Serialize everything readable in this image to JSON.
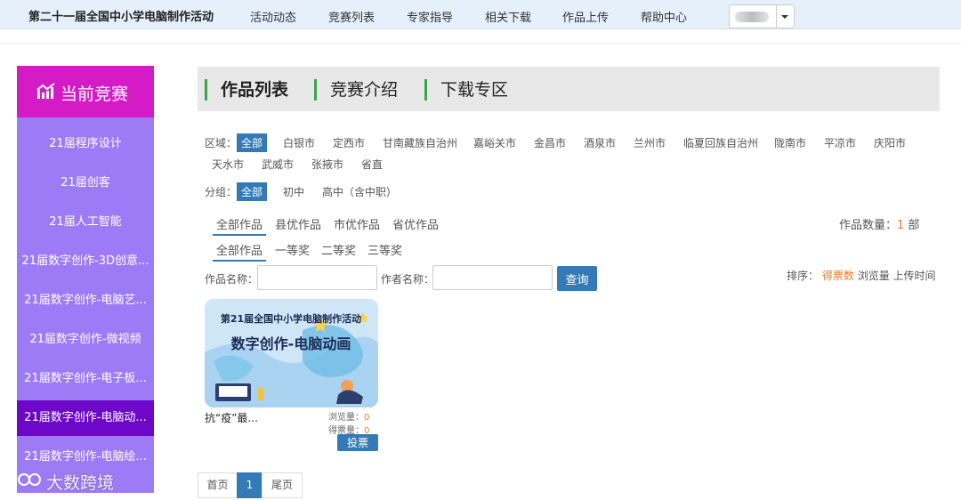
{
  "header": {
    "site_title": "第二十一届全国中小学电脑制作活动",
    "nav": [
      "活动动态",
      "竞赛列表",
      "专家指导",
      "相关下载",
      "作品上传",
      "帮助中心"
    ]
  },
  "sidebar": {
    "header_label": "当前竞赛",
    "items": [
      {
        "label": "21届程序设计"
      },
      {
        "label": "21届创客"
      },
      {
        "label": "21届人工智能"
      },
      {
        "label": "21届数字创作-3D创意..."
      },
      {
        "label": "21届数字创作-电脑艺..."
      },
      {
        "label": "21届数字创作-微视频"
      },
      {
        "label": "21届数字创作-电子板..."
      },
      {
        "label": "21届数字创作-电脑动..."
      },
      {
        "label": "21届数字创作-电脑绘..."
      }
    ]
  },
  "tabs": [
    "作品列表",
    "竞赛介绍",
    "下载专区"
  ],
  "filters": {
    "region_label": "区域：",
    "regions": [
      "全部",
      "白银市",
      "定西市",
      "甘南藏族自治州",
      "嘉峪关市",
      "金昌市",
      "酒泉市",
      "兰州市",
      "临夏回族自治州",
      "陇南市",
      "平凉市",
      "庆阳市",
      "天水市",
      "武威市",
      "张掖市",
      "省直"
    ],
    "group_label": "分组：",
    "groups": [
      "全部",
      "初中",
      "高中（含中职）"
    ],
    "levels": [
      "全部作品",
      "县优作品",
      "市优作品",
      "省优作品"
    ],
    "awards": [
      "全部作品",
      "一等奖",
      "二等奖",
      "三等奖"
    ]
  },
  "count": {
    "label": "作品数量：",
    "value": "1",
    "unit": " 部"
  },
  "search": {
    "work_name_label": "作品名称：",
    "author_label": "作者名称：",
    "query_button": "查询"
  },
  "sort": {
    "label": "排序：",
    "options": [
      "得票数",
      "浏览量",
      "上传时间"
    ]
  },
  "card": {
    "banner_title": "第21届全国中小学电脑制作活动",
    "banner_subtitle": "数字创作-电脑动画",
    "title": "抗“疫”最...",
    "views_label": "浏览量：",
    "views": "0",
    "votes_label": "得票量：",
    "votes": "0",
    "vote_button": "投票"
  },
  "pagination": {
    "first": "首页",
    "current": "1",
    "last": "尾页"
  },
  "watermark": "大数跨境",
  "colors": {
    "accent_blue": "#337ab7",
    "sidebar_header": "#d51bc6",
    "sidebar_bg": "#9d7bf6",
    "sidebar_active": "#6d08c9",
    "tab_marker": "#3fa34d",
    "highlight_orange": "#ee7b2e"
  }
}
